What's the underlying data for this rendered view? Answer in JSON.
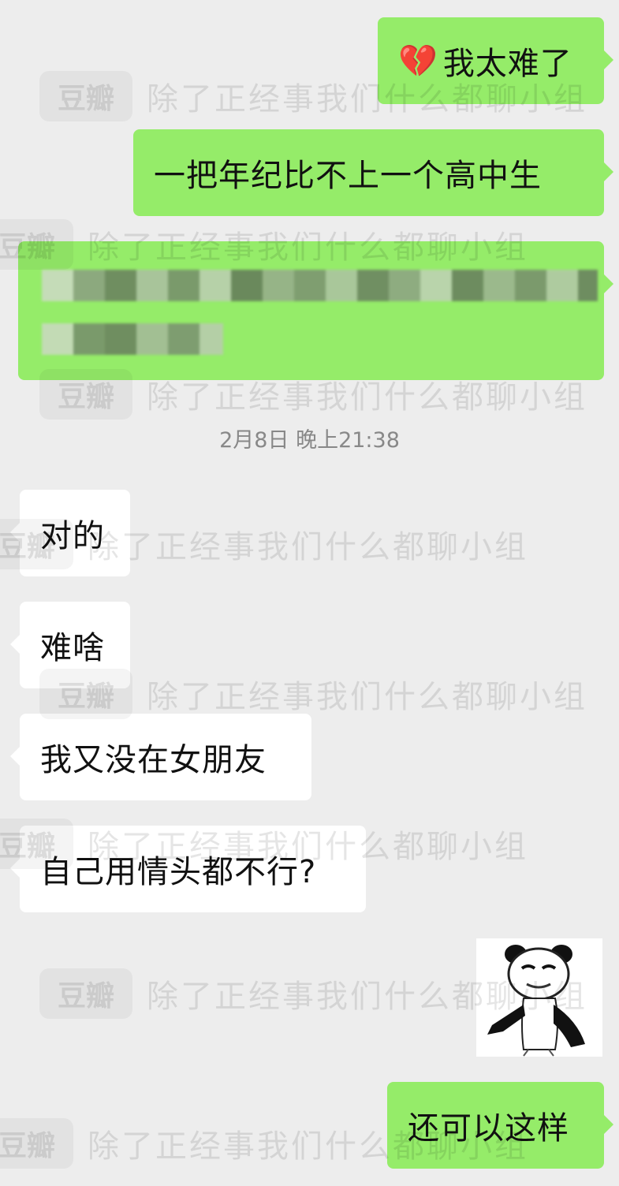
{
  "watermark": {
    "logo": "豆瓣",
    "text": "除了正经事我们什么都聊小组"
  },
  "messages": [
    {
      "id": "m1",
      "side": "sent",
      "emoji": "💔",
      "text": "我太难了"
    },
    {
      "id": "m2",
      "side": "sent",
      "text": "一把年纪比不上一个高中生"
    },
    {
      "id": "m3",
      "side": "sent",
      "blurred": true
    },
    {
      "id": "ts",
      "type": "timestamp",
      "text": "2月8日 晚上21:38"
    },
    {
      "id": "m4",
      "side": "received",
      "text": "对的"
    },
    {
      "id": "m5",
      "side": "received",
      "text": "难啥"
    },
    {
      "id": "m6",
      "side": "received",
      "text": "我又没在女朋友"
    },
    {
      "id": "m7",
      "side": "received",
      "text": "自己用情头都不行?"
    },
    {
      "id": "m8",
      "side": "sent",
      "type": "sticker",
      "sticker": "panda-meme-sticker"
    },
    {
      "id": "m9",
      "side": "sent",
      "text": "还可以这样"
    }
  ]
}
